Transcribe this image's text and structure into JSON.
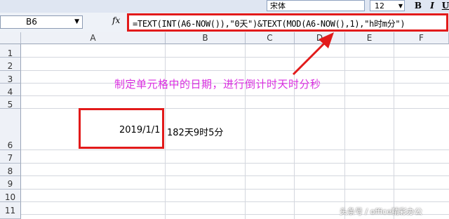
{
  "toolbar": {
    "font_name": "宋体",
    "font_size": "12",
    "bold_label": "B",
    "italic_label": "I",
    "underline_label": "U"
  },
  "formula_bar": {
    "name_box": "B6",
    "fx_label": "fx",
    "formula": "=TEXT(INT(A6-NOW()),\"0天\")&TEXT(MOD(A6-NOW(),1),\"h时m分\")"
  },
  "columns": [
    "A",
    "B",
    "C",
    "D",
    "E",
    "F"
  ],
  "rows": [
    "1",
    "2",
    "3",
    "4",
    "5",
    "6",
    "7",
    "8",
    "9",
    "10",
    "11"
  ],
  "cells": {
    "A6": "2019/1/1",
    "B6": "182天9时5分"
  },
  "annotation": "制定单元格中的日期，进行倒计时天时分秒",
  "watermark": "头条号 / office精彩办公",
  "colors": {
    "highlight_red": "#e21a1a",
    "annotation_magenta": "#d92ee0"
  }
}
